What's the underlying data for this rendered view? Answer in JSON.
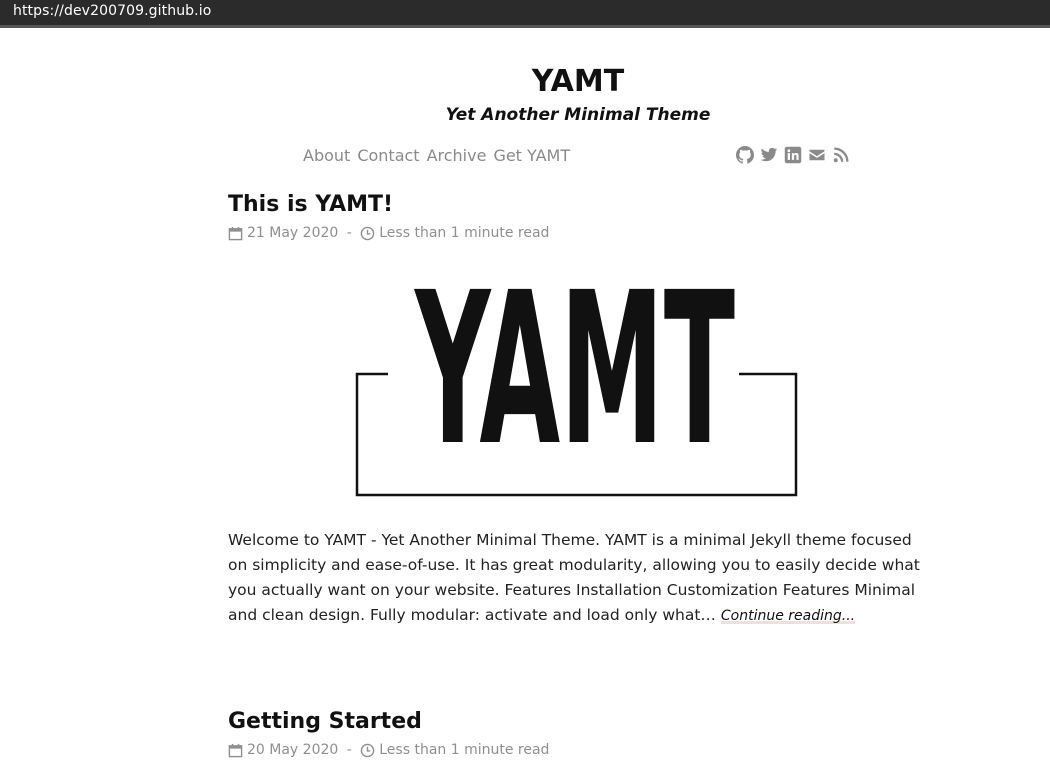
{
  "browser": {
    "url": "https://dev200709.github.io"
  },
  "site": {
    "title": "YAMT",
    "subtitle": "Yet Another Minimal Theme"
  },
  "nav": {
    "items": [
      {
        "label": "About"
      },
      {
        "label": "Contact"
      },
      {
        "label": "Archive"
      },
      {
        "label": "Get YAMT"
      }
    ]
  },
  "social": {
    "icons": [
      "github-icon",
      "twitter-icon",
      "linkedin-icon",
      "envelope-icon",
      "rss-icon"
    ]
  },
  "posts": [
    {
      "title": "This is YAMT!",
      "date": "21 May 2020",
      "separator": " - ",
      "read_time": "Less than 1 minute read",
      "image_text": "YAMT",
      "excerpt": "Welcome to YAMT - Yet Another Minimal Theme. YAMT is a minimal Jekyll theme focused on simplicity and ease-of-use. It has great modularity, allowing you to easily decide what you actually want on your website. Features Installation Customization Features Minimal and clean design. Fully modular: activate and load only what…",
      "continue_label": "Continue reading..."
    },
    {
      "title": "Getting Started",
      "date": "20 May 2020",
      "separator": " - ",
      "read_time": "Less than 1 minute read"
    }
  ],
  "colors": {
    "text": "#111111",
    "muted": "#8f8f8f",
    "urlbar": "#2b2b2b"
  }
}
